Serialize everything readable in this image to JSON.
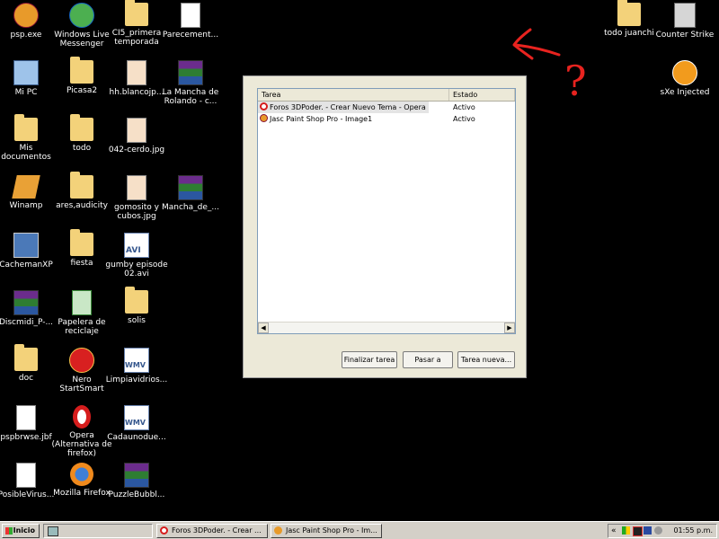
{
  "desktop": {
    "icons": [
      {
        "label": "psp.exe"
      },
      {
        "label": "Windows Live Messenger"
      },
      {
        "label": "CI5_primera temporada"
      },
      {
        "label": "Parecement..."
      },
      {
        "label": "Mi PC"
      },
      {
        "label": "Picasa2"
      },
      {
        "label": "hh.blancojp..."
      },
      {
        "label": "La Mancha de Rolando - c..."
      },
      {
        "label": "Mis documentos"
      },
      {
        "label": "todo"
      },
      {
        "label": "042-cerdo.jpg"
      },
      {
        "label": "Winamp"
      },
      {
        "label": "ares,audicity"
      },
      {
        "label": "gomosito y cubos.jpg"
      },
      {
        "label": "Mancha_de_..."
      },
      {
        "label": "CachemanXP"
      },
      {
        "label": "fiesta"
      },
      {
        "label": "gumby episode 02.avi"
      },
      {
        "label": "Discmidi_P-..."
      },
      {
        "label": "Papelera de reciclaje"
      },
      {
        "label": "solis"
      },
      {
        "label": "doc"
      },
      {
        "label": "Nero StartSmart"
      },
      {
        "label": "Limpiavidrios..."
      },
      {
        "label": "pspbrwse.jbf"
      },
      {
        "label": "Opera (Alternativa de firefox)"
      },
      {
        "label": "Cadaunodue..."
      },
      {
        "label": "PosibleVirus..."
      },
      {
        "label": "Mozilla Firefox"
      },
      {
        "label": "PuzzleBubbl..."
      },
      {
        "label": "todo juanchi"
      },
      {
        "label": "Counter Strike"
      },
      {
        "label": "sXe Injected"
      }
    ]
  },
  "task_manager": {
    "columns": [
      "Tarea",
      "Estado"
    ],
    "rows": [
      {
        "name": "Foros 3DPoder. - Crear Nuevo Tema - Opera",
        "status": "Activo"
      },
      {
        "name": "Jasc Paint Shop Pro - Image1",
        "status": "Activo"
      }
    ],
    "buttons": {
      "end_task": "Finalizar tarea",
      "switch_to": "Pasar a",
      "new_task": "Tarea nueva..."
    }
  },
  "annotation": {
    "text": "?",
    "color": "#e8231f"
  },
  "taskbar": {
    "start_label": "Inicio",
    "tasks": [
      {
        "label": "Foros 3DPoder. - Crear ..."
      },
      {
        "label": "Jasc Paint Shop Pro - Im..."
      }
    ],
    "tray_chevron": "«",
    "clock": "01:55 p.m."
  }
}
